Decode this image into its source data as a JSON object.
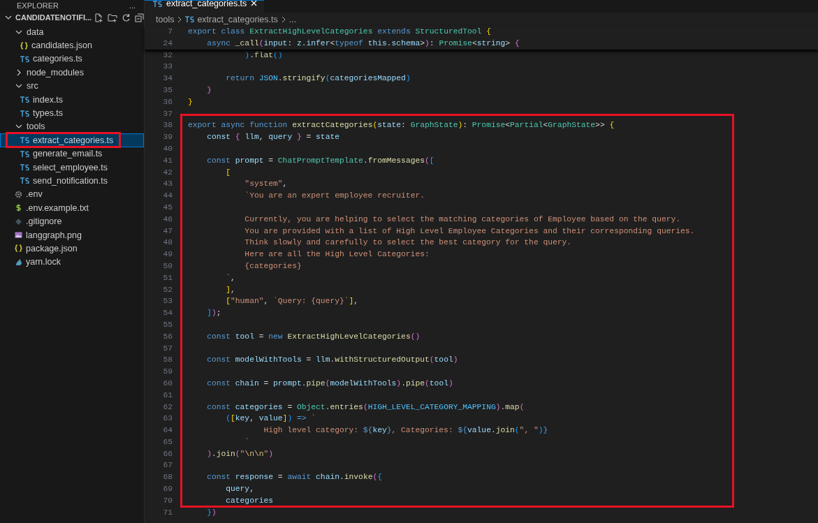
{
  "sidebar": {
    "title": "EXPLORER",
    "more": "...",
    "root": {
      "label": "CANDIDATENOTIFI...",
      "expanded": true
    },
    "items": [
      {
        "label": "data",
        "kind": "folder",
        "expanded": true,
        "selected": false,
        "children": [
          {
            "label": "candidates.json",
            "kind": "json",
            "selected": false
          },
          {
            "label": "categories.ts",
            "kind": "ts",
            "selected": false
          }
        ]
      },
      {
        "label": "node_modules",
        "kind": "folder",
        "expanded": false,
        "selected": false
      },
      {
        "label": "src",
        "kind": "folder",
        "expanded": true,
        "selected": false,
        "children": [
          {
            "label": "index.ts",
            "kind": "ts",
            "selected": false
          },
          {
            "label": "types.ts",
            "kind": "ts",
            "selected": false
          }
        ]
      },
      {
        "label": "tools",
        "kind": "folder",
        "expanded": true,
        "selected": false,
        "children": [
          {
            "label": "extract_categories.ts",
            "kind": "ts",
            "selected": true
          },
          {
            "label": "generate_email.ts",
            "kind": "ts",
            "selected": false
          },
          {
            "label": "select_employee.ts",
            "kind": "ts",
            "selected": false
          },
          {
            "label": "send_notification.ts",
            "kind": "ts",
            "selected": false
          }
        ]
      },
      {
        "label": ".env",
        "kind": "gear",
        "selected": false
      },
      {
        "label": ".env.example.txt",
        "kind": "dollar",
        "selected": false
      },
      {
        "label": ".gitignore",
        "kind": "git",
        "selected": false
      },
      {
        "label": "langgraph.png",
        "kind": "image",
        "selected": false
      },
      {
        "label": "package.json",
        "kind": "json",
        "selected": false
      },
      {
        "label": "yarn.lock",
        "kind": "yarn",
        "selected": false
      }
    ]
  },
  "tabs": [
    {
      "label": "extract_categories.ts",
      "kind": "ts",
      "selected": true
    }
  ],
  "breadcrumb": [
    "tools",
    "extract_categories.ts",
    "..."
  ],
  "sticky_lines": [
    {
      "number": "7",
      "text": "export class ExtractHighLevelCategories extends StructuredTool {"
    },
    {
      "number": "24",
      "text": "    async _call(input: z.infer<typeof this.schema>): Promise<string> {"
    }
  ],
  "lines": [
    {
      "number": "32",
      "text": "            ).flat()"
    },
    {
      "number": "33"
    },
    {
      "number": "34",
      "text": "        return JSON.stringify(categoriesMapped)"
    },
    {
      "number": "35",
      "text": "    }"
    },
    {
      "number": "36",
      "text": "}"
    },
    {
      "number": "37"
    },
    {
      "number": "38",
      "text": "export async function extractCategories(state: GraphState): Promise<Partial<GraphState>> {"
    },
    {
      "number": "39",
      "text": "    const { llm, query } = state"
    },
    {
      "number": "40"
    },
    {
      "number": "41",
      "text": "    const prompt = ChatPromptTemplate.fromMessages(["
    },
    {
      "number": "42",
      "text": "        ["
    },
    {
      "number": "43",
      "text": "            \"system\","
    },
    {
      "number": "44",
      "text": "            `You are an expert employee recruiter."
    },
    {
      "number": "45"
    },
    {
      "number": "46",
      "text": "            Currently, you are helping to select the matching categories of Employee based on the query."
    },
    {
      "number": "47",
      "text": "            You are provided with a list of High Level Employee Categories and their corresponding queries."
    },
    {
      "number": "48",
      "text": "            Think slowly and carefully to select the best category for the query."
    },
    {
      "number": "49",
      "text": "            Here are all the High Level Categories:"
    },
    {
      "number": "50",
      "text": "            {categories}"
    },
    {
      "number": "51",
      "text": "        `,"
    },
    {
      "number": "52",
      "text": "        ],"
    },
    {
      "number": "53",
      "text": "        [\"human\", `Query: {query}`],"
    },
    {
      "number": "54",
      "text": "    ]);"
    },
    {
      "number": "55"
    },
    {
      "number": "56",
      "text": "    const tool = new ExtractHighLevelCategories()"
    },
    {
      "number": "57"
    },
    {
      "number": "58",
      "text": "    const modelWithTools = llm.withStructuredOutput(tool)"
    },
    {
      "number": "59"
    },
    {
      "number": "60",
      "text": "    const chain = prompt.pipe(modelWithTools).pipe(tool)"
    },
    {
      "number": "61"
    },
    {
      "number": "62",
      "text": "    const categories = Object.entries(HIGH_LEVEL_CATEGORY_MAPPING).map("
    },
    {
      "number": "63",
      "text": "        ([key, value]) => `"
    },
    {
      "number": "64",
      "text": "                High level category: ${key}, Categories: ${value.join(\", \")}"
    },
    {
      "number": "65",
      "text": "            `"
    },
    {
      "number": "66",
      "text": "    ).join(\"\\n\\n\")"
    },
    {
      "number": "67"
    },
    {
      "number": "68",
      "text": "    const response = await chain.invoke({"
    },
    {
      "number": "69",
      "text": "        query,"
    },
    {
      "number": "70",
      "text": "        categories"
    },
    {
      "number": "71",
      "text": "    })"
    }
  ]
}
